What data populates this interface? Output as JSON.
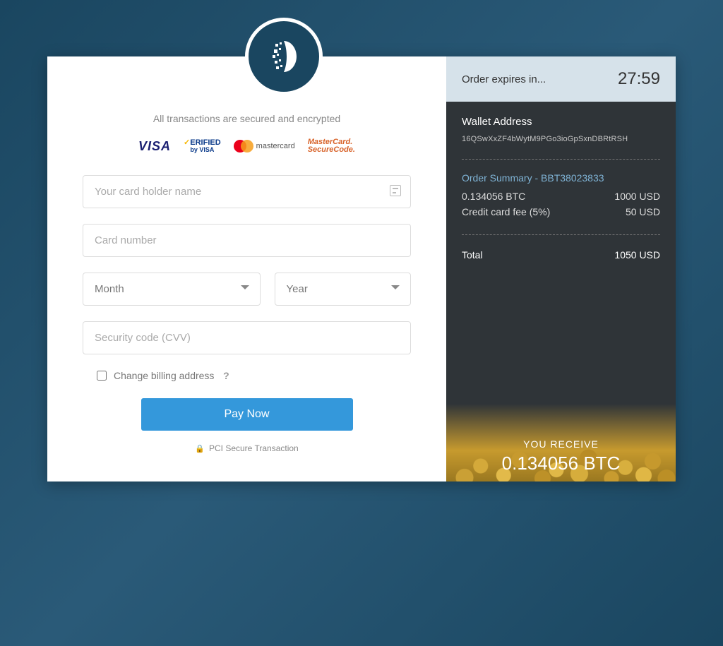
{
  "header": {
    "secured_text": "All transactions are secured and encrypted"
  },
  "logos": {
    "visa": "VISA",
    "vbv_top": "ERIFIED",
    "vbv_bot": "by VISA",
    "mc_text": "mastercard",
    "msc_top": "MasterCard.",
    "msc_bot": "SecureCode."
  },
  "form": {
    "cardholder_placeholder": "Your card holder name",
    "cardnumber_placeholder": "Card number",
    "month_placeholder": "Month",
    "year_placeholder": "Year",
    "cvv_placeholder": "Security code (CVV)",
    "billing_label": "Change billing address",
    "help": "?",
    "pay_label": "Pay Now",
    "pci_label": "PCI Secure Transaction"
  },
  "sidebar": {
    "timer_label": "Order expires in...",
    "timer_value": "27:59",
    "wallet_title": "Wallet Address",
    "wallet_addr": "16QSwXxZF4bWytM9PGo3ioGpSxnDBRtRSH",
    "order_summary_label": "Order Summary - BBT38023833",
    "line1_left": "0.134056 BTC",
    "line1_right": "1000 USD",
    "line2_left": "Credit card fee (5%)",
    "line2_right": "50 USD",
    "total_left": "Total",
    "total_right": "1050 USD",
    "receive_label": "YOU RECEIVE",
    "receive_amount": "0.134056 BTC"
  }
}
